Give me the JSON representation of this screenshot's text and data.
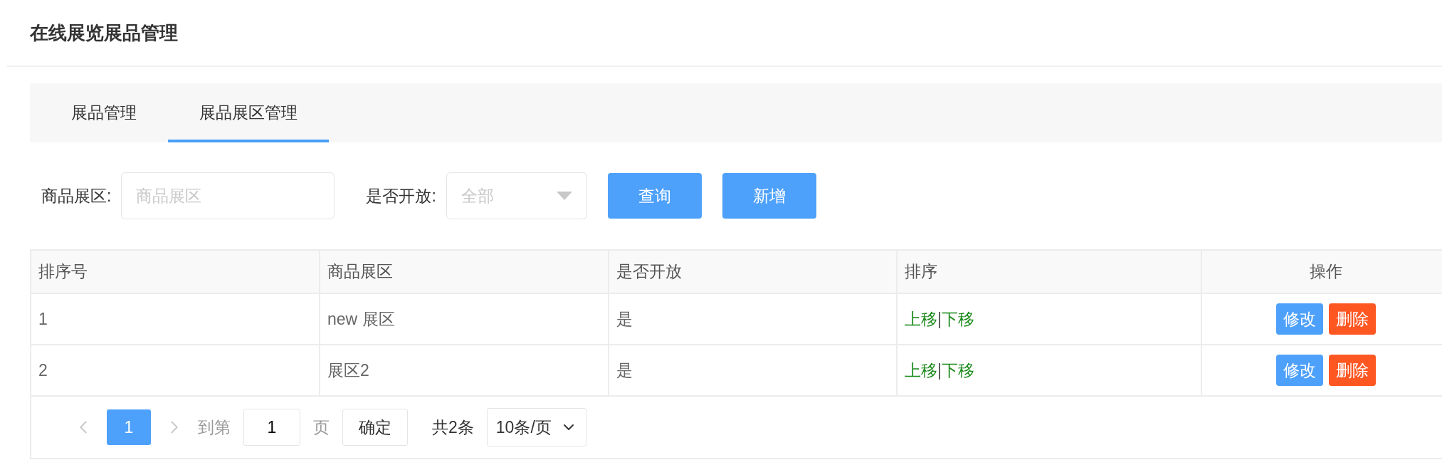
{
  "page_title": "在线展览展品管理",
  "tabs": [
    {
      "label": "展品管理",
      "selected": false
    },
    {
      "label": "展品展区管理",
      "selected": true
    }
  ],
  "filters": {
    "zone": {
      "label": "商品展区:",
      "placeholder": "商品展区"
    },
    "open": {
      "label": "是否开放:",
      "value": "全部"
    }
  },
  "actions": [
    "查询",
    "新增"
  ],
  "table": {
    "columns": [
      "排序号",
      "商品展区",
      "是否开放",
      "排序",
      "操作"
    ],
    "rows": [
      {
        "cells": [
          "1",
          "new 展区",
          "是"
        ],
        "move_up": "上移",
        "separator": "|",
        "move_down": "下移",
        "buttons": [
          {
            "label": "修改",
            "kind": "edit"
          },
          {
            "label": "删除",
            "kind": "delete"
          }
        ]
      },
      {
        "cells": [
          "2",
          "展区2",
          "是"
        ],
        "move_up": "上移",
        "separator": "|",
        "move_down": "下移",
        "buttons": [
          {
            "label": "修改",
            "kind": "edit"
          },
          {
            "label": "删除",
            "kind": "delete"
          }
        ]
      }
    ]
  },
  "pagination": {
    "prev_disabled": true,
    "next_disabled": true,
    "pages": [
      {
        "label": "1",
        "selected": true
      }
    ],
    "goto_label": "到第",
    "goto_value": "1",
    "page_unit": "页",
    "confirm": "确定",
    "total": "共2条",
    "page_size": "10条/页"
  }
}
